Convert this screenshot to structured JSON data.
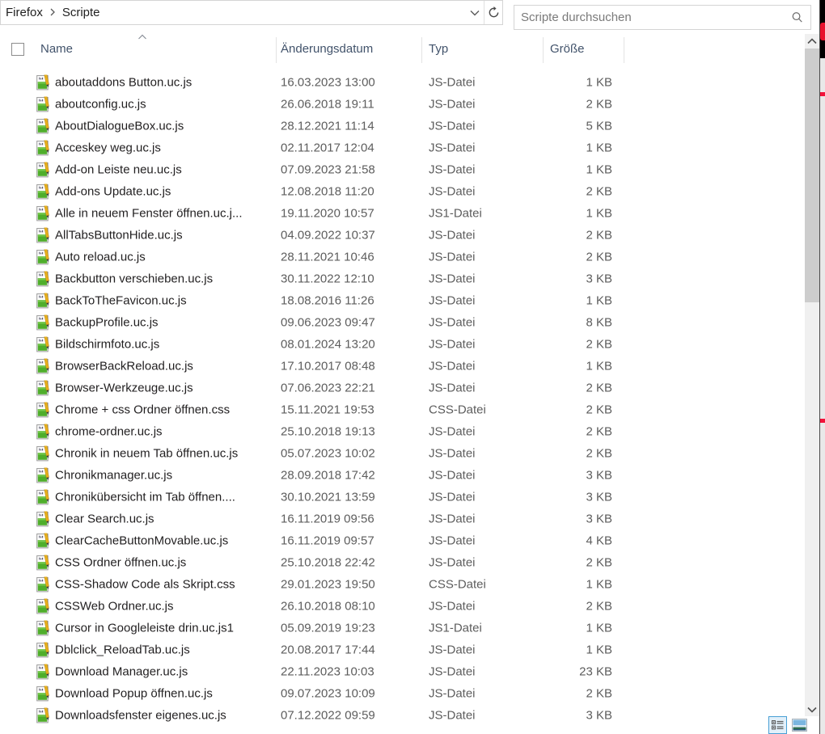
{
  "topbar": {
    "breadcrumb": {
      "root": "Firefox",
      "current": "Scripte"
    },
    "search": {
      "placeholder": "Scripte durchsuchen"
    }
  },
  "columns": {
    "name": "Name",
    "date": "Änderungsdatum",
    "type": "Typ",
    "size": "Größe"
  },
  "sort": {
    "column": "name",
    "direction": "ascending"
  },
  "colors": {
    "header_text": "#42536b",
    "secondary_text": "#5d5d5d",
    "selection_accent": "#49a0d5",
    "icon_green": "#4fae2b",
    "icon_pencil_yellow": "#e8b01e",
    "edge_marker_red": "#e8112d"
  },
  "rows": [
    {
      "name": "aboutaddons Button.uc.js",
      "date": "16.03.2023 13:00",
      "type": "JS-Datei",
      "size": "1 KB"
    },
    {
      "name": "aboutconfig.uc.js",
      "date": "26.06.2018 19:11",
      "type": "JS-Datei",
      "size": "2 KB"
    },
    {
      "name": "AboutDialogueBox.uc.js",
      "date": "28.12.2021 11:14",
      "type": "JS-Datei",
      "size": "5 KB"
    },
    {
      "name": "Acceskey weg.uc.js",
      "date": "02.11.2017 12:04",
      "type": "JS-Datei",
      "size": "1 KB"
    },
    {
      "name": "Add-on Leiste neu.uc.js",
      "date": "07.09.2023 21:58",
      "type": "JS-Datei",
      "size": "1 KB"
    },
    {
      "name": "Add-ons Update.uc.js",
      "date": "12.08.2018 11:20",
      "type": "JS-Datei",
      "size": "2 KB"
    },
    {
      "name": "Alle in neuem Fenster öffnen.uc.j...",
      "date": "19.11.2020 10:57",
      "type": "JS1-Datei",
      "size": "1 KB"
    },
    {
      "name": "AllTabsButtonHide.uc.js",
      "date": "04.09.2022 10:37",
      "type": "JS-Datei",
      "size": "2 KB"
    },
    {
      "name": "Auto reload.uc.js",
      "date": "28.11.2021 10:46",
      "type": "JS-Datei",
      "size": "2 KB"
    },
    {
      "name": "Backbutton verschieben.uc.js",
      "date": "30.11.2022 12:10",
      "type": "JS-Datei",
      "size": "3 KB"
    },
    {
      "name": "BackToTheFavicon.uc.js",
      "date": "18.08.2016 11:26",
      "type": "JS-Datei",
      "size": "1 KB"
    },
    {
      "name": "BackupProfile.uc.js",
      "date": "09.06.2023 09:47",
      "type": "JS-Datei",
      "size": "8 KB"
    },
    {
      "name": "Bildschirmfoto.uc.js",
      "date": "08.01.2024 13:20",
      "type": "JS-Datei",
      "size": "2 KB"
    },
    {
      "name": "BrowserBackReload.uc.js",
      "date": "17.10.2017 08:48",
      "type": "JS-Datei",
      "size": "1 KB"
    },
    {
      "name": "Browser-Werkzeuge.uc.js",
      "date": "07.06.2023 22:21",
      "type": "JS-Datei",
      "size": "2 KB"
    },
    {
      "name": "Chrome + css Ordner öffnen.css",
      "date": "15.11.2021 19:53",
      "type": "CSS-Datei",
      "size": "2 KB"
    },
    {
      "name": "chrome-ordner.uc.js",
      "date": "25.10.2018 19:13",
      "type": "JS-Datei",
      "size": "2 KB"
    },
    {
      "name": "Chronik in neuem Tab öffnen.uc.js",
      "date": "05.07.2023 10:02",
      "type": "JS-Datei",
      "size": "2 KB"
    },
    {
      "name": "Chronikmanager.uc.js",
      "date": "28.09.2018 17:42",
      "type": "JS-Datei",
      "size": "3 KB"
    },
    {
      "name": "Chronikübersicht im Tab öffnen....",
      "date": "30.10.2021 13:59",
      "type": "JS-Datei",
      "size": "3 KB"
    },
    {
      "name": "Clear Search.uc.js",
      "date": "16.11.2019 09:56",
      "type": "JS-Datei",
      "size": "3 KB"
    },
    {
      "name": "ClearCacheButtonMovable.uc.js",
      "date": "16.11.2019 09:57",
      "type": "JS-Datei",
      "size": "4 KB"
    },
    {
      "name": "CSS Ordner öffnen.uc.js",
      "date": "25.10.2018 22:42",
      "type": "JS-Datei",
      "size": "2 KB"
    },
    {
      "name": "CSS-Shadow Code als Skript.css",
      "date": "29.01.2023 19:50",
      "type": "CSS-Datei",
      "size": "1 KB"
    },
    {
      "name": "CSSWeb Ordner.uc.js",
      "date": "26.10.2018 08:10",
      "type": "JS-Datei",
      "size": "2 KB"
    },
    {
      "name": "Cursor in Googleleiste drin.uc.js1",
      "date": "05.09.2019 19:23",
      "type": "JS1-Datei",
      "size": "1 KB"
    },
    {
      "name": "Dblclick_ReloadTab.uc.js",
      "date": "20.08.2017 17:44",
      "type": "JS-Datei",
      "size": "1 KB"
    },
    {
      "name": "Download Manager.uc.js",
      "date": "22.11.2023 10:03",
      "type": "JS-Datei",
      "size": "23 KB"
    },
    {
      "name": "Download Popup öffnen.uc.js",
      "date": "09.07.2023 10:09",
      "type": "JS-Datei",
      "size": "2 KB"
    },
    {
      "name": "Downloadsfenster eigenes.uc.js",
      "date": "07.12.2022 09:59",
      "type": "JS-Datei",
      "size": "3 KB"
    }
  ]
}
